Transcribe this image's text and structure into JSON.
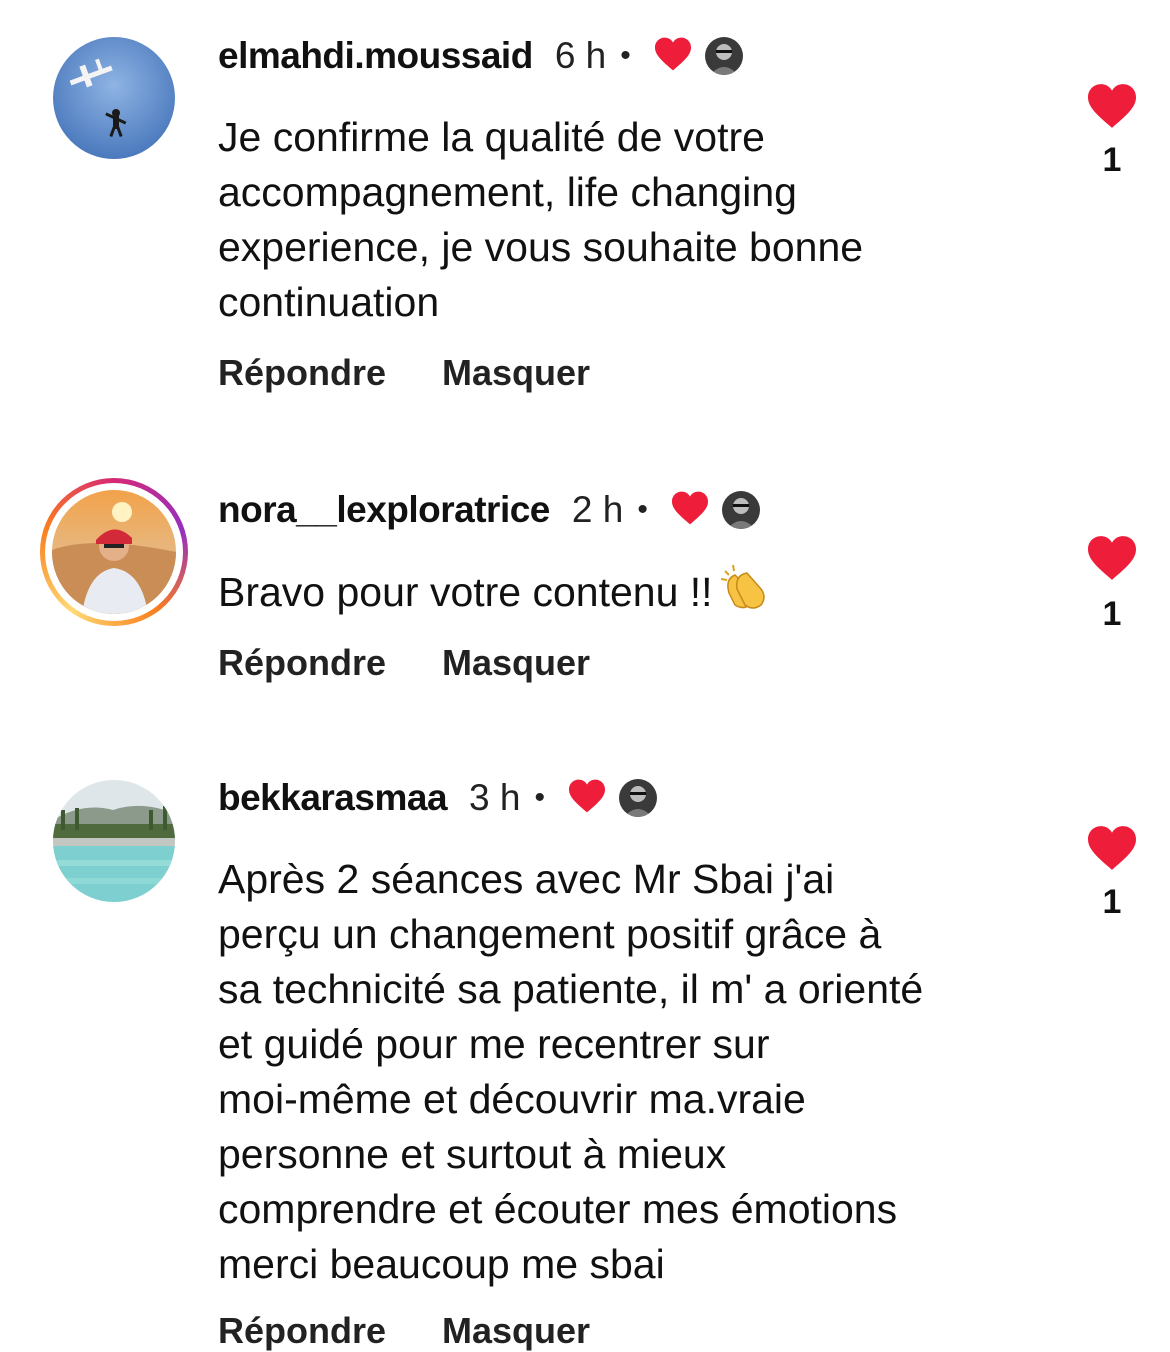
{
  "comments": [
    {
      "username": "elmahdi.moussaid",
      "time": "6 h",
      "separator": "•",
      "text": "Je confirme la qualité de votre\naccompagnement, life changing\nexperience, je vous souhaite bonne\ncontinuation",
      "reply_label": "Répondre",
      "hide_label": "Masquer",
      "like_count": "1",
      "avatar_icon": "skydiver-plane-avatar"
    },
    {
      "username": "nora__lexploratrice",
      "time": "2 h",
      "separator": "•",
      "text": "Bravo pour votre contenu !!",
      "emoji": "clapping-hands-icon",
      "reply_label": "Répondre",
      "hide_label": "Masquer",
      "like_count": "1",
      "avatar_icon": "desert-portrait-avatar",
      "has_story": true
    },
    {
      "username": "bekkarasmaa",
      "time": "3 h",
      "separator": "•",
      "text": "Après 2 séances avec Mr Sbai j'ai\nperçu un changement positif  grâce à\nsa technicité sa patiente, il m' a orienté\net guidé pour me recentrer sur\nmoi-même et découvrir ma.vraie\npersonne et surtout à mieux\ncomprendre et écouter mes émotions\nmerci beaucoup me sbai",
      "reply_label": "Répondre",
      "hide_label": "Masquer",
      "like_count": "1",
      "avatar_icon": "pool-landscape-avatar"
    }
  ],
  "colors": {
    "heart": "#ee1d3a",
    "text": "#111111",
    "story_ring": "#d62976"
  }
}
